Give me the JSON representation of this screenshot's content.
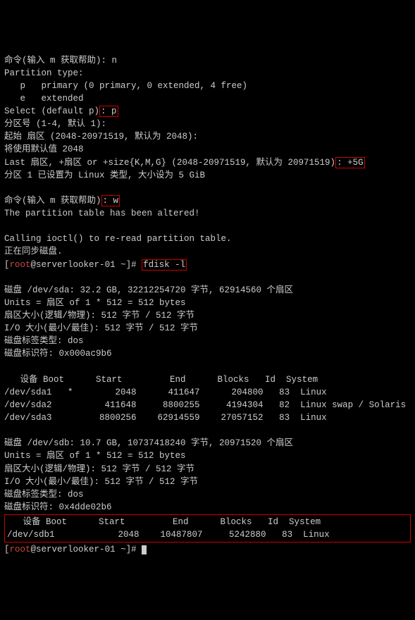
{
  "lines": {
    "l1_pre": "命令(输入 m 获取帮助): ",
    "l1_in": "n",
    "l2": "Partition type:",
    "l3": "   p   primary (0 primary, 0 extended, 4 free)",
    "l4": "   e   extended",
    "l5_pre": "Select (default p)",
    "l5_hl": ": p",
    "l6": "分区号 (1-4, 默认 1):",
    "l7": "起始 扇区 (2048-20971519, 默认为 2048):",
    "l8": "将使用默认值 2048",
    "l9_pre": "Last 扇区, +扇区 or +size{K,M,G} (2048-20971519, 默认为 20971519)",
    "l9_hl": ": +5G",
    "l10": "分区 1 已设置为 Linux 类型, 大小设为 5 GiB",
    "l11_pre": "命令(输入 m 获取帮助)",
    "l11_hl": ": w",
    "l12": "The partition table has been altered!",
    "l13": "Calling ioctl() to re-read partition table.",
    "l14": "正在同步磁盘.",
    "prompt_user": "root",
    "prompt_at": "@",
    "prompt_host": "serverlooker-01 ",
    "prompt_path": "~",
    "prompt_end": "]# ",
    "cmd_fdisk": "fdisk -l",
    "sda_h1": "磁盘 /dev/sda: 32.2 GB, 32212254720 字节, 62914560 个扇区",
    "sda_h2": "Units = 扇区 of 1 * 512 = 512 bytes",
    "sda_h3": "扇区大小(逻辑/物理): 512 字节 / 512 字节",
    "sda_h4": "I/O 大小(最小/最佳): 512 字节 / 512 字节",
    "sda_h5": "磁盘标签类型: dos",
    "sda_h6": "磁盘标识符: 0x000ac9b6",
    "thead": "   设备 Boot      Start         End      Blocks   Id  System",
    "sda_r1": "/dev/sda1   *        2048      411647      204800   83  Linux",
    "sda_r2": "/dev/sda2          411648     8800255     4194304   82  Linux swap / Solaris",
    "sda_r3": "/dev/sda3         8800256    62914559    27057152   83  Linux",
    "sdb_h1": "磁盘 /dev/sdb: 10.7 GB, 10737418240 字节, 20971520 个扇区",
    "sdb_h2": "Units = 扇区 of 1 * 512 = 512 bytes",
    "sdb_h3": "扇区大小(逻辑/物理): 512 字节 / 512 字节",
    "sdb_h4": "I/O 大小(最小/最佳): 512 字节 / 512 字节",
    "sdb_h5": "磁盘标签类型: dos",
    "sdb_h6": "磁盘标识符: 0x4dde02b6",
    "thead2": "   设备 Boot      Start         End      Blocks   Id  System",
    "sdb_r1": "/dev/sdb1            2048    10487807     5242880   83  Linux"
  }
}
